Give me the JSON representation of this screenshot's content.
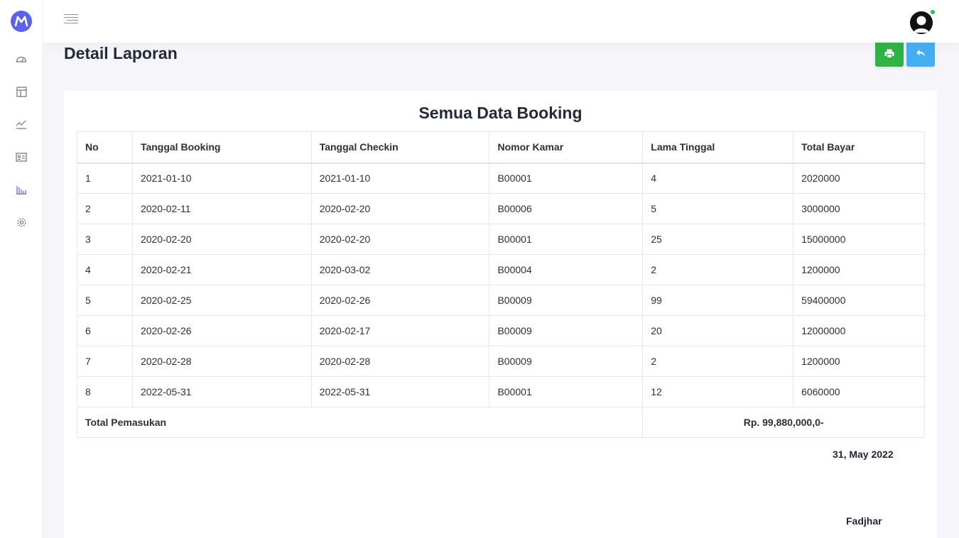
{
  "sidebar": {
    "icons": [
      "dashboard-icon",
      "layout-icon",
      "trend-chart-icon",
      "id-card-icon",
      "bar-chart-icon",
      "settings-gear-icon"
    ],
    "active_color": "#6c63e8"
  },
  "page": {
    "title": "Detail Laporan"
  },
  "report": {
    "title": "Semua Data Booking",
    "columns": [
      "No",
      "Tanggal Booking",
      "Tanggal Checkin",
      "Nomor Kamar",
      "Lama Tinggal",
      "Total Bayar"
    ],
    "rows": [
      [
        "1",
        "2021-01-10",
        "2021-01-10",
        "B00001",
        "4",
        "2020000"
      ],
      [
        "2",
        "2020-02-11",
        "2020-02-20",
        "B00006",
        "5",
        "3000000"
      ],
      [
        "3",
        "2020-02-20",
        "2020-02-20",
        "B00001",
        "25",
        "15000000"
      ],
      [
        "4",
        "2020-02-21",
        "2020-03-02",
        "B00004",
        "2",
        "1200000"
      ],
      [
        "5",
        "2020-02-25",
        "2020-02-26",
        "B00009",
        "99",
        "59400000"
      ],
      [
        "6",
        "2020-02-26",
        "2020-02-17",
        "B00009",
        "20",
        "12000000"
      ],
      [
        "7",
        "2020-02-28",
        "2020-02-28",
        "B00009",
        "2",
        "1200000"
      ],
      [
        "8",
        "2022-05-31",
        "2022-05-31",
        "B00001",
        "12",
        "6060000"
      ]
    ],
    "total_label": "Total Pemasukan",
    "total_value": "Rp. 99,880,000,0-",
    "date": "31, May 2022",
    "signer": "Fadjhar"
  },
  "colors": {
    "print_button": "#2fb344",
    "back_button": "#45aef3",
    "logo": "#5a63ea",
    "online_status": "#2dbd4e"
  }
}
